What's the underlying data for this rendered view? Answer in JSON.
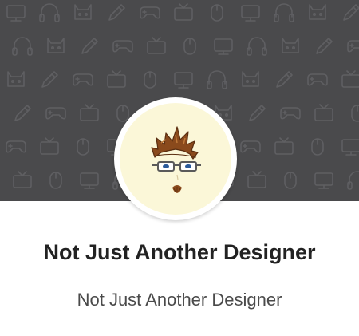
{
  "profile": {
    "name": "Not Just Another Designer",
    "subtitle": "Not Just Another Designer"
  },
  "cover": {
    "background_color": "#4a4a4c",
    "pattern_color": "#5f5f62",
    "pattern_icons": [
      "monitor-icon",
      "headphones-icon",
      "cat-icon",
      "pencil-icon",
      "gamepad-icon",
      "tv-icon",
      "mouse-icon"
    ]
  },
  "avatar": {
    "icon": "designer-cartoon-avatar",
    "background_color": "#fbf7d8",
    "ring_color": "#ffffff"
  }
}
